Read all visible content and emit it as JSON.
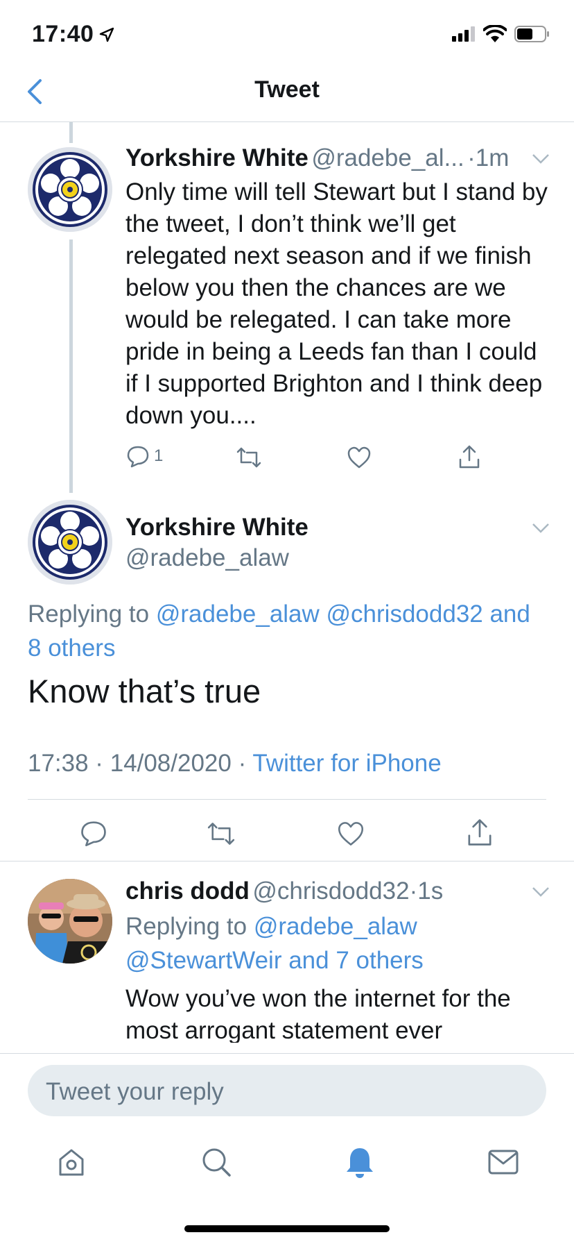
{
  "status_bar": {
    "time": "17:40"
  },
  "nav": {
    "title": "Tweet"
  },
  "parent_tweet": {
    "name": "Yorkshire White",
    "handle": "@radebe_al...",
    "time": "·1m",
    "text": "Only time will tell Stewart but I stand by the tweet, I don’t think we’ll get relegated next season and if we finish below you then the chances are we would be relegated. I can take more pride in being a Leeds fan than I could if I supported Brighton and I think deep down you....",
    "reply_count": "1"
  },
  "main_tweet": {
    "name": "Yorkshire White",
    "handle": "@radebe_alaw",
    "replying_prefix": "Replying to",
    "replying_to": "@radebe_alaw @chrisdodd32 and",
    "replying_to_2": "8 others",
    "text": "Know that’s true",
    "timestamp": "17:38 · 14/08/2020 ·",
    "source": "Twitter for iPhone"
  },
  "reply_tweet": {
    "name": "chris dodd",
    "handle": "@chrisdodd32",
    "time": "·1s",
    "replying_prefix": "Replying to",
    "replying_to": "@radebe_alaw",
    "replying_to_2": "@StewartWeir and 7 others",
    "text_line1": "Wow you’ve won the internet for the",
    "text_line2": "most arrogant statement ever"
  },
  "composer": {
    "placeholder": "Tweet your reply"
  },
  "tab_bar": {
    "icons": [
      "home-icon",
      "search-icon",
      "notifications-icon",
      "messages-icon"
    ]
  },
  "colors": {
    "accent": "#4a90d9",
    "text": "#14171a",
    "secondary": "#657786"
  }
}
